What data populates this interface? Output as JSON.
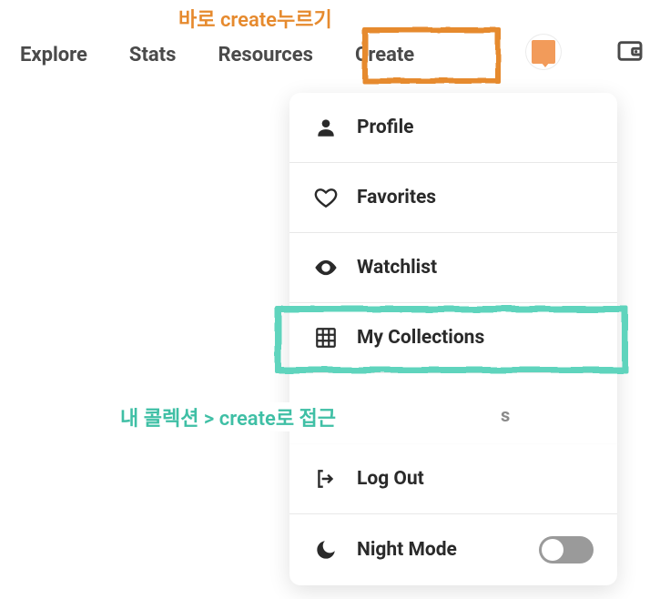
{
  "annotations": {
    "top": "바로 create누르기",
    "mid": "내 콜렉션 >  create로 접근",
    "mid_tail": "s"
  },
  "nav": {
    "explore": "Explore",
    "stats": "Stats",
    "resources": "Resources",
    "create": "Create"
  },
  "menu": {
    "profile": "Profile",
    "favorites": "Favorites",
    "watchlist": "Watchlist",
    "my_collections": "My Collections",
    "log_out": "Log Out",
    "night_mode": "Night Mode"
  },
  "icons": {
    "profile": "person",
    "favorites": "heart",
    "watchlist": "eye",
    "my_collections": "grid",
    "log_out": "exit",
    "night_mode": "moon",
    "wallet": "wallet"
  },
  "toggle": {
    "night_mode_on": false
  }
}
